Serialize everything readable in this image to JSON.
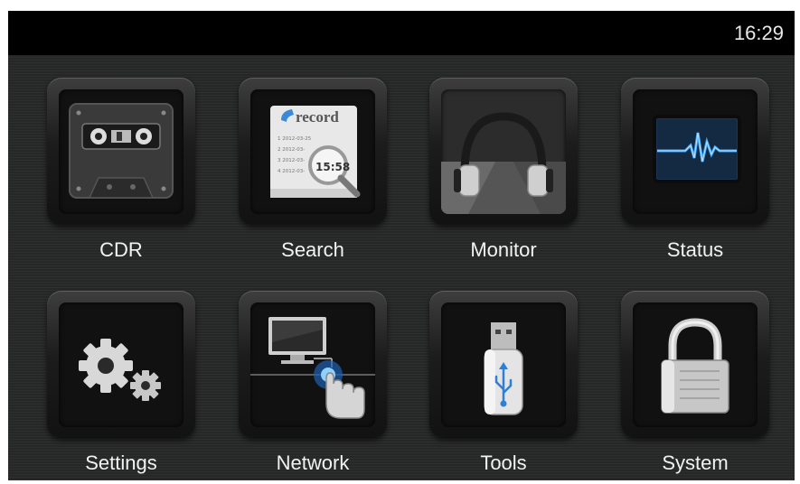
{
  "statusbar": {
    "time": "16:29"
  },
  "tiles": [
    {
      "label": "CDR",
      "icon": "cassette-icon"
    },
    {
      "label": "Search",
      "icon": "record-search-icon",
      "icon_text": {
        "heading": "record",
        "time": "15:58",
        "rows": [
          "1 2012-03-25",
          "2 2012-03-",
          "3 2012-03-",
          "4 2012-03-"
        ]
      }
    },
    {
      "label": "Monitor",
      "icon": "headphones-icon"
    },
    {
      "label": "Status",
      "icon": "waveform-monitor-icon"
    },
    {
      "label": "Settings",
      "icon": "gears-icon"
    },
    {
      "label": "Network",
      "icon": "computer-touch-icon"
    },
    {
      "label": "Tools",
      "icon": "usb-drive-icon"
    },
    {
      "label": "System",
      "icon": "padlock-icon"
    }
  ],
  "colors": {
    "background": "#262727",
    "topbar": "#000000",
    "label": "#f2f2f2",
    "accent_blue": "#3fa8ff"
  }
}
